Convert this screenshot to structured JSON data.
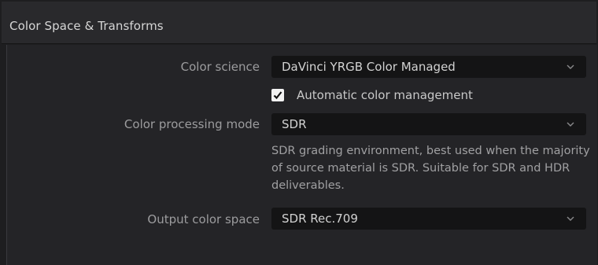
{
  "panel": {
    "title": "Color Space & Transforms"
  },
  "color_science": {
    "label": "Color science",
    "value": "DaVinci YRGB Color Managed"
  },
  "auto_color_management": {
    "label": "Automatic color management",
    "checked": true
  },
  "color_processing_mode": {
    "label": "Color processing mode",
    "value": "SDR",
    "description": "SDR grading environment, best used when the majority of source material is SDR. Suitable for SDR and HDR deliverables."
  },
  "output_color_space": {
    "label": "Output color space",
    "value": "SDR Rec.709"
  },
  "icons": {
    "dropdown_chevron": "chevron-down-icon",
    "checkbox_check": "checkmark-icon"
  },
  "colors": {
    "panel_bg": "#242427",
    "header_bg": "#29292c",
    "dropdown_bg": "#141415",
    "label_text": "#9c9c9e",
    "value_text": "#d2d2d2"
  }
}
